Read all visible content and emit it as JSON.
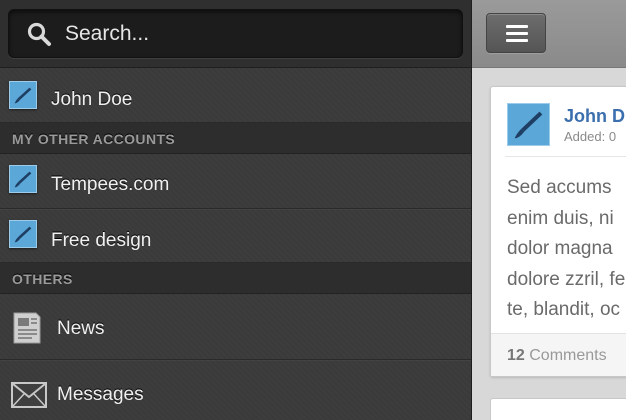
{
  "search": {
    "placeholder": "Search..."
  },
  "sidebar": {
    "primary_account": {
      "label": "John Doe",
      "icon": "account-brush-icon"
    },
    "other_accounts_header": "MY OTHER ACCOUNTS",
    "other_accounts": [
      {
        "label": "Tempees.com",
        "icon": "account-brush-icon"
      },
      {
        "label": "Free design",
        "icon": "account-brush-icon"
      }
    ],
    "others_header": "OTHERS",
    "others": [
      {
        "label": "News",
        "icon": "newspaper-icon"
      },
      {
        "label": "Messages",
        "icon": "envelope-icon"
      }
    ]
  },
  "topbar": {
    "menu_icon": "hamburger-menu-icon"
  },
  "post": {
    "author": "John D",
    "added": "Added: 0",
    "body_lines": [
      "Sed accums",
      "enim duis, ni",
      "dolor magna",
      "dolore zzril, fe",
      "te, blandit, oc"
    ],
    "comments_count": "12",
    "comments_label": "Comments"
  },
  "colors": {
    "accent": "#5aa7d8",
    "sidebar_bg": "#3b3b3b",
    "author_link": "#3b6fae"
  }
}
